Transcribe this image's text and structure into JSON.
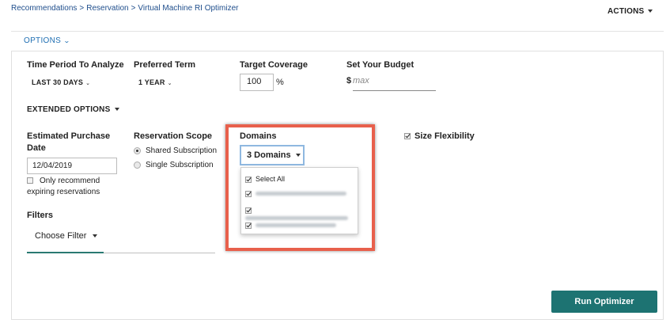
{
  "breadcrumb": {
    "items": [
      "Recommendations",
      "Reservation",
      "Virtual Machine RI Optimizer"
    ],
    "separator": ">"
  },
  "header": {
    "actions_label": "ACTIONS"
  },
  "options": {
    "label": "OPTIONS"
  },
  "time_period": {
    "label": "Time Period To Analyze",
    "value": "LAST 30 DAYS"
  },
  "preferred_term": {
    "label": "Preferred Term",
    "value": "1 YEAR"
  },
  "target_coverage": {
    "label": "Target Coverage",
    "value": "100",
    "unit": "%"
  },
  "budget": {
    "label": "Set Your Budget",
    "currency": "$",
    "placeholder": "max"
  },
  "extended_options": {
    "label": "EXTENDED OPTIONS"
  },
  "purchase_date": {
    "label_line1": "Estimated Purchase",
    "label_line2": "Date",
    "value": "12/04/2019",
    "expiring_label_line1": "Only recommend",
    "expiring_label_line2": "expiring reservations"
  },
  "reservation_scope": {
    "label": "Reservation Scope",
    "options": [
      "Shared Subscription",
      "Single Subscription"
    ],
    "selected": "Shared Subscription"
  },
  "domains": {
    "label": "Domains",
    "button_label": "3 Domains",
    "select_all_label": "Select All"
  },
  "size_flexibility": {
    "label": "Size Flexibility",
    "checked": true
  },
  "filters": {
    "label": "Filters",
    "choose_label": "Choose Filter"
  },
  "run_button": {
    "label": "Run Optimizer"
  },
  "colors": {
    "accent": "#1d7372",
    "link": "#1f6fb3",
    "highlight": "#e8604c"
  }
}
